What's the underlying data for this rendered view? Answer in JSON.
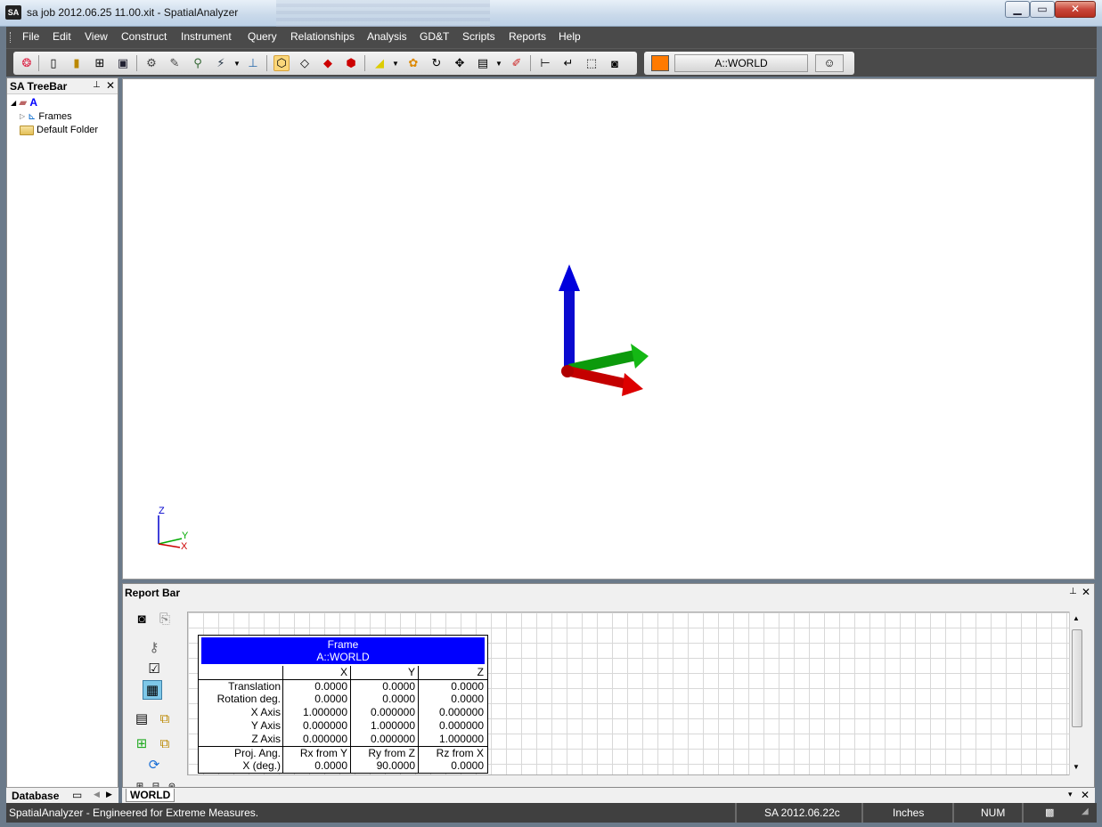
{
  "window": {
    "app_icon": "SA",
    "title": "sa job 2012.06.25 11.00.xit - SpatialAnalyzer",
    "min": "▁",
    "max": "▭",
    "close": "✕"
  },
  "menu": [
    "File",
    "Edit",
    "View",
    "Construct",
    "Instrument",
    "Query",
    "Relationships",
    "Analysis",
    "GD&T",
    "Scripts",
    "Reports",
    "Help"
  ],
  "toolbar": {
    "active_frame": "A::WORLD",
    "swatch_color": "#ff7a00"
  },
  "treebar": {
    "title": "SA TreeBar",
    "pin": "⊥",
    "close": "✕",
    "root": "A",
    "frames": "Frames",
    "default_folder": "Default Folder",
    "tab": "Database"
  },
  "viewport": {
    "mini_triad": {
      "z": "Z",
      "y": "Y",
      "x": "X"
    }
  },
  "reportbar": {
    "title": "Report Bar",
    "pin": "⊥",
    "close": "✕",
    "table": {
      "title1": "Frame",
      "title2": "A::WORLD",
      "headers": [
        "",
        "X",
        "Y",
        "Z"
      ],
      "rows": [
        [
          "Translation",
          "0.0000",
          "0.0000",
          "0.0000"
        ],
        [
          "Rotation deg.",
          "0.0000",
          "0.0000",
          "0.0000"
        ],
        [
          "X Axis",
          "1.000000",
          "0.000000",
          "0.000000"
        ],
        [
          "Y Axis",
          "0.000000",
          "1.000000",
          "0.000000"
        ],
        [
          "Z Axis",
          "0.000000",
          "0.000000",
          "1.000000"
        ],
        [
          "Proj. Ang.",
          "Rx from Y",
          "Ry from Z",
          "Rz from X"
        ],
        [
          "X (deg.)",
          "0.0000",
          "90.0000",
          "0.0000"
        ]
      ]
    },
    "tab": "WORLD"
  },
  "status": {
    "message": "SpatialAnalyzer - Engineered for Extreme Measures.",
    "version": "SA 2012.06.22c",
    "units": "Inches",
    "num": "NUM"
  },
  "colors": {
    "x_axis": "#cc0000",
    "y_axis": "#00aa00",
    "z_axis": "#0000cc",
    "report_header": "#0000ff"
  }
}
